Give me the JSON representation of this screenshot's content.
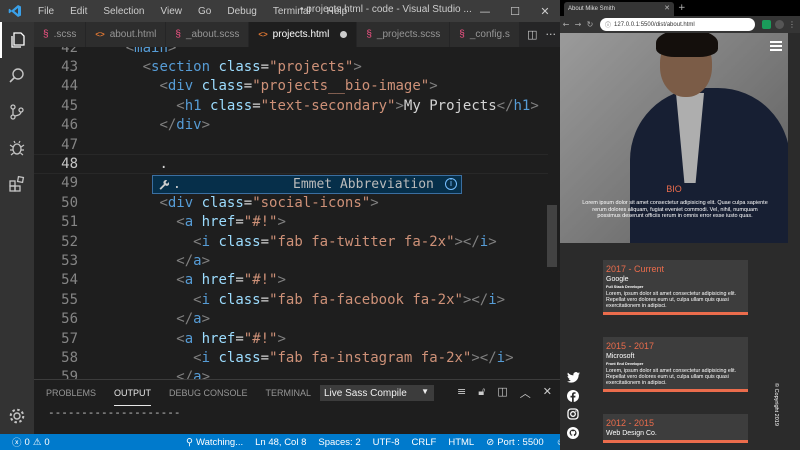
{
  "vscode": {
    "menu": [
      "File",
      "Edit",
      "Selection",
      "View",
      "Go",
      "Debug",
      "Terminal",
      "Help"
    ],
    "window_title": "• projects.html - code - Visual Studio ...",
    "tabs": [
      {
        "label": ".scss",
        "kind": "scss",
        "active": false
      },
      {
        "label": "about.html",
        "kind": "html",
        "active": false
      },
      {
        "label": "_about.scss",
        "kind": "scss",
        "active": false
      },
      {
        "label": "projects.html",
        "kind": "html",
        "active": true,
        "dirty": true
      },
      {
        "label": "_projects.scss",
        "kind": "scss",
        "active": false
      },
      {
        "label": "_config.s",
        "kind": "scss",
        "active": false
      }
    ],
    "code_lines": [
      {
        "n": "42",
        "indent": "    ",
        "tokens": [
          [
            "t-punct",
            "<"
          ],
          [
            "t-tag",
            "main"
          ],
          [
            "t-punct",
            ">"
          ]
        ]
      },
      {
        "n": "43",
        "indent": "      ",
        "tokens": [
          [
            "t-punct",
            "<"
          ],
          [
            "t-tag",
            "section"
          ],
          [
            "t-text",
            " "
          ],
          [
            "t-attr",
            "class"
          ],
          [
            "t-text",
            "="
          ],
          [
            "t-str",
            "\"projects\""
          ],
          [
            "t-punct",
            ">"
          ]
        ]
      },
      {
        "n": "44",
        "indent": "        ",
        "tokens": [
          [
            "t-punct",
            "<"
          ],
          [
            "t-tag",
            "div"
          ],
          [
            "t-text",
            " "
          ],
          [
            "t-attr",
            "class"
          ],
          [
            "t-text",
            "="
          ],
          [
            "t-str",
            "\"projects__bio-image\""
          ],
          [
            "t-punct",
            ">"
          ]
        ]
      },
      {
        "n": "45",
        "indent": "          ",
        "tokens": [
          [
            "t-punct",
            "<"
          ],
          [
            "t-tag",
            "h1"
          ],
          [
            "t-text",
            " "
          ],
          [
            "t-attr",
            "class"
          ],
          [
            "t-text",
            "="
          ],
          [
            "t-str",
            "\"text-secondary\""
          ],
          [
            "t-punct",
            ">"
          ],
          [
            "t-text",
            "My Projects"
          ],
          [
            "t-punct",
            "</"
          ],
          [
            "t-tag",
            "h1"
          ],
          [
            "t-punct",
            ">"
          ]
        ]
      },
      {
        "n": "46",
        "indent": "        ",
        "tokens": [
          [
            "t-punct",
            "</"
          ],
          [
            "t-tag",
            "div"
          ],
          [
            "t-punct",
            ">"
          ]
        ]
      },
      {
        "n": "47",
        "indent": "",
        "tokens": []
      },
      {
        "n": "48",
        "indent": "        ",
        "tokens": [
          [
            "t-text",
            "."
          ]
        ],
        "current": true
      },
      {
        "n": "49",
        "indent": "",
        "tokens": []
      },
      {
        "n": "50",
        "indent": "        ",
        "tokens": [
          [
            "t-punct",
            "<"
          ],
          [
            "t-tag",
            "div"
          ],
          [
            "t-text",
            " "
          ],
          [
            "t-attr",
            "class"
          ],
          [
            "t-text",
            "="
          ],
          [
            "t-str",
            "\"social-icons\""
          ],
          [
            "t-punct",
            ">"
          ]
        ]
      },
      {
        "n": "51",
        "indent": "          ",
        "tokens": [
          [
            "t-punct",
            "<"
          ],
          [
            "t-tag",
            "a"
          ],
          [
            "t-text",
            " "
          ],
          [
            "t-attr",
            "href"
          ],
          [
            "t-text",
            "="
          ],
          [
            "t-str",
            "\"#!\""
          ],
          [
            "t-punct",
            ">"
          ]
        ]
      },
      {
        "n": "52",
        "indent": "            ",
        "tokens": [
          [
            "t-punct",
            "<"
          ],
          [
            "t-tag",
            "i"
          ],
          [
            "t-text",
            " "
          ],
          [
            "t-attr",
            "class"
          ],
          [
            "t-text",
            "="
          ],
          [
            "t-str",
            "\"fab fa-twitter fa-2x\""
          ],
          [
            "t-punct",
            "></"
          ],
          [
            "t-tag",
            "i"
          ],
          [
            "t-punct",
            ">"
          ]
        ]
      },
      {
        "n": "53",
        "indent": "          ",
        "tokens": [
          [
            "t-punct",
            "</"
          ],
          [
            "t-tag",
            "a"
          ],
          [
            "t-punct",
            ">"
          ]
        ]
      },
      {
        "n": "54",
        "indent": "          ",
        "tokens": [
          [
            "t-punct",
            "<"
          ],
          [
            "t-tag",
            "a"
          ],
          [
            "t-text",
            " "
          ],
          [
            "t-attr",
            "href"
          ],
          [
            "t-text",
            "="
          ],
          [
            "t-str",
            "\"#!\""
          ],
          [
            "t-punct",
            ">"
          ]
        ]
      },
      {
        "n": "55",
        "indent": "            ",
        "tokens": [
          [
            "t-punct",
            "<"
          ],
          [
            "t-tag",
            "i"
          ],
          [
            "t-text",
            " "
          ],
          [
            "t-attr",
            "class"
          ],
          [
            "t-text",
            "="
          ],
          [
            "t-str",
            "\"fab fa-facebook fa-2x\""
          ],
          [
            "t-punct",
            "></"
          ],
          [
            "t-tag",
            "i"
          ],
          [
            "t-punct",
            ">"
          ]
        ]
      },
      {
        "n": "56",
        "indent": "          ",
        "tokens": [
          [
            "t-punct",
            "</"
          ],
          [
            "t-tag",
            "a"
          ],
          [
            "t-punct",
            ">"
          ]
        ]
      },
      {
        "n": "57",
        "indent": "          ",
        "tokens": [
          [
            "t-punct",
            "<"
          ],
          [
            "t-tag",
            "a"
          ],
          [
            "t-text",
            " "
          ],
          [
            "t-attr",
            "href"
          ],
          [
            "t-text",
            "="
          ],
          [
            "t-str",
            "\"#!\""
          ],
          [
            "t-punct",
            ">"
          ]
        ]
      },
      {
        "n": "58",
        "indent": "            ",
        "tokens": [
          [
            "t-punct",
            "<"
          ],
          [
            "t-tag",
            "i"
          ],
          [
            "t-text",
            " "
          ],
          [
            "t-attr",
            "class"
          ],
          [
            "t-text",
            "="
          ],
          [
            "t-str",
            "\"fab fa-instagram fa-2x\""
          ],
          [
            "t-punct",
            "></"
          ],
          [
            "t-tag",
            "i"
          ],
          [
            "t-punct",
            ">"
          ]
        ]
      },
      {
        "n": "59",
        "indent": "          ",
        "tokens": [
          [
            "t-punct",
            "</"
          ],
          [
            "t-tag",
            "a"
          ],
          [
            "t-punct",
            ">"
          ]
        ]
      }
    ],
    "suggestion": {
      "label": ".",
      "detail": "Emmet Abbreviation",
      "info_icon": "ⓘ"
    },
    "panel": {
      "tabs": [
        "PROBLEMS",
        "OUTPUT",
        "DEBUG CONSOLE",
        "TERMINAL"
      ],
      "active_tab": "OUTPUT",
      "select_value": "Live Sass Compile",
      "output_text": "--------------------"
    },
    "status": {
      "errors": "0",
      "warnings": "0",
      "watching": "Watching...",
      "position": "Ln 48, Col 8",
      "spaces": "Spaces: 2",
      "encoding": "UTF-8",
      "eol": "CRLF",
      "language": "HTML",
      "port": "Port : 5500"
    }
  },
  "browser": {
    "tab_title": "About Mike Smith",
    "url": "127.0.0.1:5500/dist/about.html",
    "bio": {
      "title": "BIO",
      "text": "Lorem ipsum dolor sit amet consectetur adipisicing elit. Quae culpa sapiente rerum dolores aliquam, fugiat eveniet commodi. Vel, nihil, numquam possimus deserunt officiis rerum in omnis error esse iusto quas."
    },
    "jobs": [
      {
        "date": "2017 - Current",
        "company": "Google",
        "role": "Full Stack Developer",
        "desc": "Lorem, ipsum dolor sit amet consectetur adipisicing elit. Repellat vero dolores eum ut, culpa ullam quis quasi exercitationem in adipisci."
      },
      {
        "date": "2015 - 2017",
        "company": "Microsoft",
        "role": "Front End Developer",
        "desc": "Lorem, ipsum dolor sit amet consectetur adipisicing elit. Repellat vero dolores eum ut, culpa ullam quis quasi exercitationem in adipisci."
      },
      {
        "date": "2012 - 2015",
        "company": "Web Design Co.",
        "role": "",
        "desc": ""
      }
    ],
    "copyright": "© Copyright 2019"
  },
  "colors": {
    "accent": "#eb6c4c",
    "statusbar": "#007acc"
  }
}
